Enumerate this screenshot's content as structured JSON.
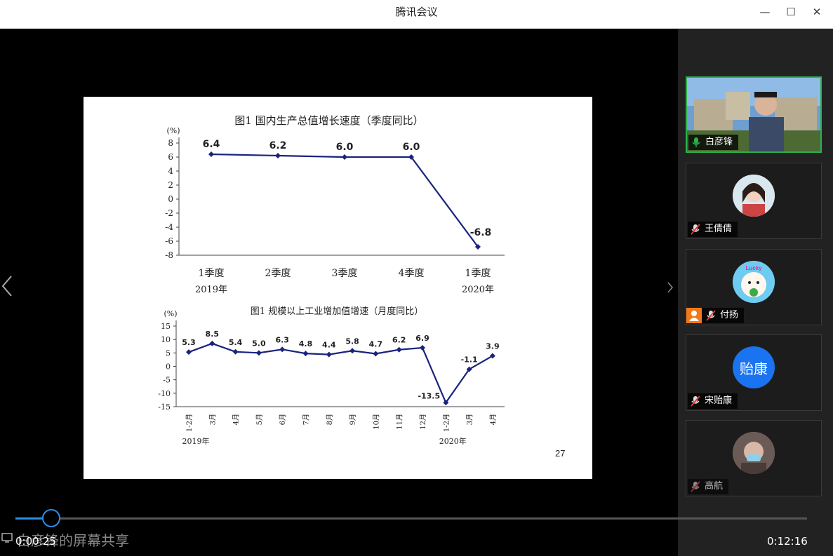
{
  "window": {
    "title": "腾讯会议",
    "minimize_glyph": "—",
    "maximize_glyph": "☐",
    "close_glyph": "✕"
  },
  "share": {
    "label": "白彦锋的屏幕共享"
  },
  "player": {
    "current_time": "0:00:25",
    "total_time": "0:12:16",
    "progress_fraction": 0.045
  },
  "participants": [
    {
      "name": "白彦锋",
      "mic": "on",
      "video": true
    },
    {
      "name": "王倩倩",
      "mic": "muted"
    },
    {
      "name": "付扬",
      "mic": "muted",
      "avatar_text": "Lucky"
    },
    {
      "name": "宋贻康",
      "mic": "muted",
      "avatar_text": "贻康"
    },
    {
      "name": "高航",
      "mic": "muted"
    }
  ],
  "slide": {
    "page_number": "27"
  },
  "chart_data": [
    {
      "type": "line",
      "title": "图1  国内生产总值增长速度（季度同比）",
      "ylabel": "(%)",
      "ylim": [
        -8,
        8
      ],
      "yticks": [
        "8",
        "6",
        "4",
        "2",
        "0",
        "-2",
        "-4",
        "-6",
        "-8"
      ],
      "categories": [
        "1季度",
        "2季度",
        "3季度",
        "4季度",
        "1季度"
      ],
      "year_labels": [
        {
          "index": 0,
          "text": "2019年"
        },
        {
          "index": 4,
          "text": "2020年"
        }
      ],
      "values": [
        6.4,
        6.2,
        6.0,
        6.0,
        -6.8
      ],
      "data_labels": [
        "6.4",
        "6.2",
        "6.0",
        "6.0",
        "-6.8"
      ],
      "color": "#1a237e"
    },
    {
      "type": "line",
      "title": "图1  规模以上工业增加值增速（月度同比）",
      "ylabel": "(%)",
      "ylim": [
        -15,
        15
      ],
      "yticks": [
        "15",
        "10",
        "5",
        "0",
        "-5",
        "-10",
        "-15"
      ],
      "categories": [
        "1-2月",
        "3月",
        "4月",
        "5月",
        "6月",
        "7月",
        "8月",
        "9月",
        "10月",
        "11月",
        "12月",
        "1-2月",
        "3月",
        "4月"
      ],
      "year_labels": [
        {
          "index": 0,
          "text": "2019年"
        },
        {
          "index": 11,
          "text": "2020年"
        }
      ],
      "values": [
        5.3,
        8.5,
        5.4,
        5.0,
        6.3,
        4.8,
        4.4,
        5.8,
        4.7,
        6.2,
        6.9,
        -13.5,
        -1.1,
        3.9
      ],
      "data_labels": [
        "5.3",
        "8.5",
        "5.4",
        "5.0",
        "6.3",
        "4.8",
        "4.4",
        "5.8",
        "4.7",
        "6.2",
        "6.9",
        "-13.5",
        "-1.1",
        "3.9"
      ],
      "color": "#1a237e"
    }
  ]
}
